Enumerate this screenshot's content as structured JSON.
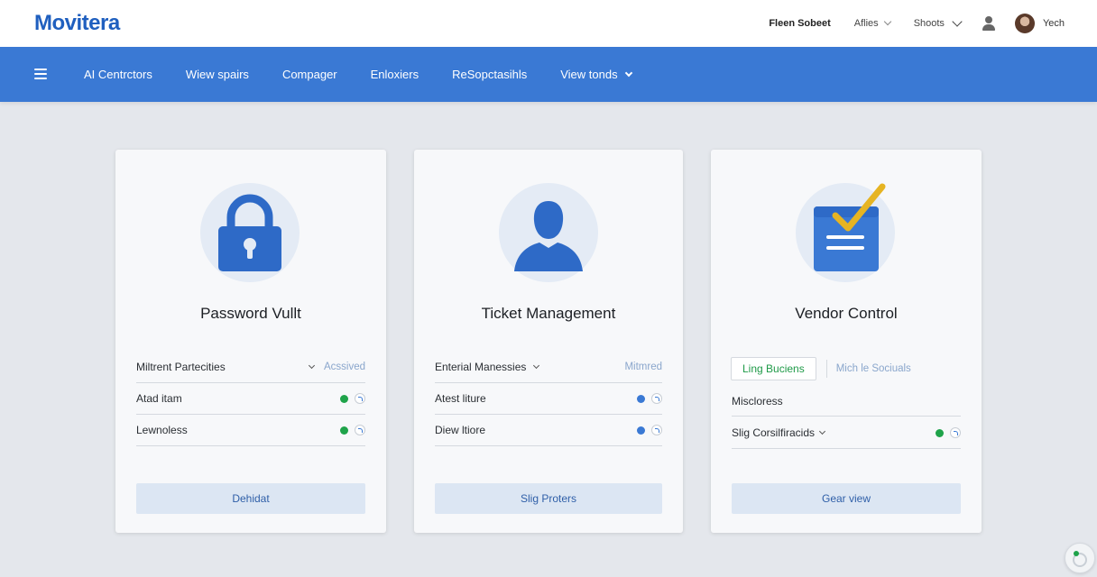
{
  "brand": {
    "logo": "Movitera",
    "color": "#1f5fbf"
  },
  "topbar": {
    "links": [
      "Fleen Sobeet",
      "Aflies",
      "Shoots"
    ],
    "user_icon": "user-icon",
    "avatar_name": "Yech"
  },
  "nav": {
    "menu_icon": "hamburger-icon",
    "items": [
      "AI Centrctors",
      "Wiew spairs",
      "Compager",
      "Enloxiers",
      "ReSopctasihls",
      "View tonds"
    ],
    "accent": "#3a79d4"
  },
  "cards": [
    {
      "icon": "lock-icon",
      "title": "Password Vullt",
      "rows": [
        {
          "label": "Miltrent Partecities",
          "right": "Acssived"
        },
        {
          "label": "Atad itam",
          "toggle": "green"
        },
        {
          "label": "Lewnoless",
          "toggle": "green"
        }
      ],
      "button": "Dehidat"
    },
    {
      "icon": "person-icon",
      "title": "Ticket Management",
      "rows": [
        {
          "label": "Enterial Manessies",
          "right": "Mitmred"
        },
        {
          "label": "Atest liture",
          "toggle": "blue"
        },
        {
          "label": "Diew ltiore",
          "toggle": "blue"
        }
      ],
      "button": "Slig Proters"
    },
    {
      "icon": "document-check-icon",
      "title": "Vendor Control",
      "segment": {
        "active": "Ling Buciens",
        "other": "Mich le Sociuals"
      },
      "rows": [
        {
          "label": "Miscloress"
        },
        {
          "label": "Slig Corsilfiracids",
          "toggle": "green"
        }
      ],
      "button": "Gear view"
    }
  ],
  "colors": {
    "green": "#1fa34a",
    "blue": "#3a79d4",
    "button_bg": "#dce6f3"
  }
}
